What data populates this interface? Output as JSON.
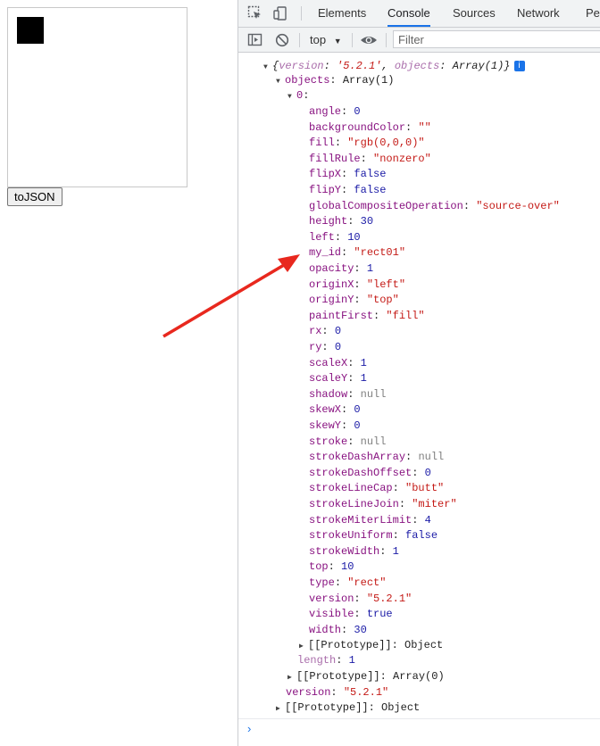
{
  "page": {
    "button_label": "toJSON"
  },
  "devtools": {
    "tabs": [
      "Elements",
      "Console",
      "Sources",
      "Network",
      "Per"
    ],
    "active_tab": "Console",
    "context": "top",
    "filter_placeholder": "Filter"
  },
  "console": {
    "summary": {
      "open": "{",
      "version_key": "version",
      "version_val": "'5.2.1'",
      "objects_key": "objects",
      "objects_val": "Array(1)",
      "close": "}",
      "info_icon": "i"
    },
    "objects_key": "objects",
    "objects_val": "Array(1)",
    "index_key": "0",
    "properties": [
      {
        "key": "angle",
        "value": "0",
        "type": "number"
      },
      {
        "key": "backgroundColor",
        "value": "\"\"",
        "type": "string"
      },
      {
        "key": "fill",
        "value": "\"rgb(0,0,0)\"",
        "type": "string"
      },
      {
        "key": "fillRule",
        "value": "\"nonzero\"",
        "type": "string"
      },
      {
        "key": "flipX",
        "value": "false",
        "type": "number"
      },
      {
        "key": "flipY",
        "value": "false",
        "type": "number"
      },
      {
        "key": "globalCompositeOperation",
        "value": "\"source-over\"",
        "type": "string"
      },
      {
        "key": "height",
        "value": "30",
        "type": "number"
      },
      {
        "key": "left",
        "value": "10",
        "type": "number"
      },
      {
        "key": "my_id",
        "value": "\"rect01\"",
        "type": "string"
      },
      {
        "key": "opacity",
        "value": "1",
        "type": "number"
      },
      {
        "key": "originX",
        "value": "\"left\"",
        "type": "string"
      },
      {
        "key": "originY",
        "value": "\"top\"",
        "type": "string"
      },
      {
        "key": "paintFirst",
        "value": "\"fill\"",
        "type": "string"
      },
      {
        "key": "rx",
        "value": "0",
        "type": "number"
      },
      {
        "key": "ry",
        "value": "0",
        "type": "number"
      },
      {
        "key": "scaleX",
        "value": "1",
        "type": "number"
      },
      {
        "key": "scaleY",
        "value": "1",
        "type": "number"
      },
      {
        "key": "shadow",
        "value": "null",
        "type": "null"
      },
      {
        "key": "skewX",
        "value": "0",
        "type": "number"
      },
      {
        "key": "skewY",
        "value": "0",
        "type": "number"
      },
      {
        "key": "stroke",
        "value": "null",
        "type": "null"
      },
      {
        "key": "strokeDashArray",
        "value": "null",
        "type": "null"
      },
      {
        "key": "strokeDashOffset",
        "value": "0",
        "type": "number"
      },
      {
        "key": "strokeLineCap",
        "value": "\"butt\"",
        "type": "string"
      },
      {
        "key": "strokeLineJoin",
        "value": "\"miter\"",
        "type": "string"
      },
      {
        "key": "strokeMiterLimit",
        "value": "4",
        "type": "number"
      },
      {
        "key": "strokeUniform",
        "value": "false",
        "type": "number"
      },
      {
        "key": "strokeWidth",
        "value": "1",
        "type": "number"
      },
      {
        "key": "top",
        "value": "10",
        "type": "number"
      },
      {
        "key": "type",
        "value": "\"rect\"",
        "type": "string"
      },
      {
        "key": "version",
        "value": "\"5.2.1\"",
        "type": "string"
      },
      {
        "key": "visible",
        "value": "true",
        "type": "number"
      },
      {
        "key": "width",
        "value": "30",
        "type": "number"
      }
    ],
    "inner_prototype": {
      "key": "[[Prototype]]",
      "value": "Object"
    },
    "length": {
      "key": "length",
      "value": "1"
    },
    "array_prototype": {
      "key": "[[Prototype]]",
      "value": "Array(0)"
    },
    "version": {
      "key": "version",
      "value": "\"5.2.1\""
    },
    "outer_prototype": {
      "key": "[[Prototype]]",
      "value": "Object"
    },
    "prompt": "›"
  },
  "colors": {
    "annotation_arrow": "#e8281e",
    "accent": "#1a73e8",
    "property_key": "#881280",
    "string_value": "#c41a16",
    "number_value": "#1a1aa6",
    "null_value": "#808080"
  }
}
